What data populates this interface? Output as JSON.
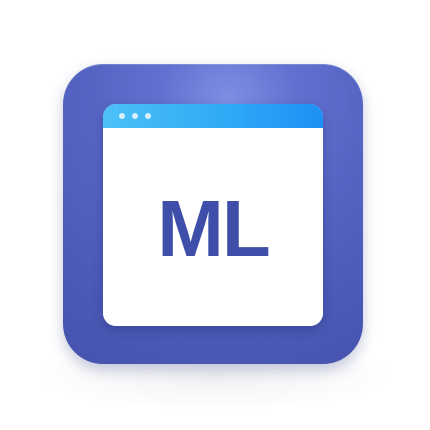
{
  "app_icon": {
    "label": "ML",
    "colors": {
      "tile": "#5564c2",
      "title_bar": "#30aaf6",
      "window": "#ffffff",
      "label": "#3f4ea8"
    },
    "icons": {
      "tile": "ml-app-icon",
      "window": "browser-window-icon",
      "controls": "window-dots-icon"
    }
  }
}
